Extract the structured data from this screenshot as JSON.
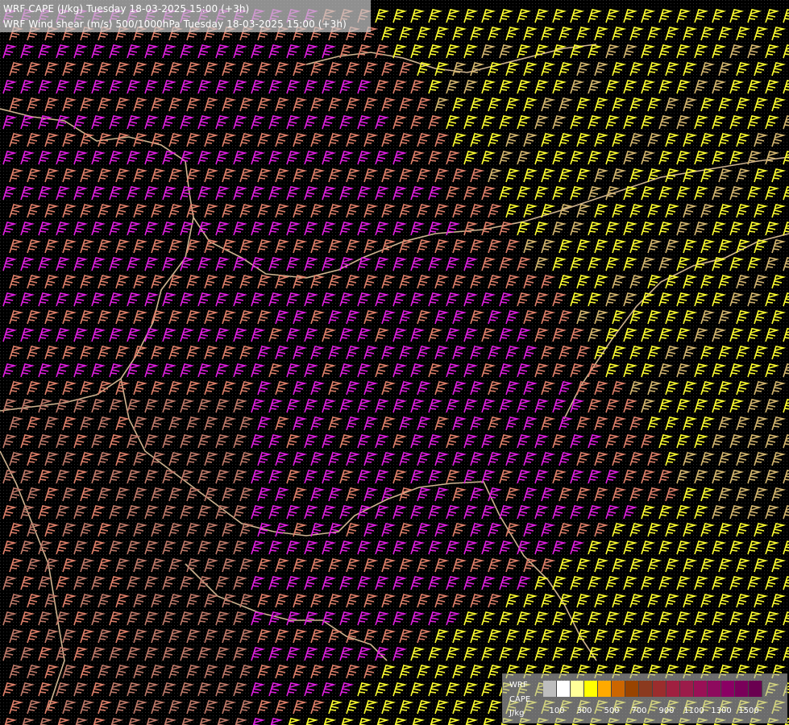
{
  "header": {
    "line1": "WRF CAPE (J/kg) Tuesday 18-03-2025 15:00 (+3h)",
    "line2": "WRF Wind shear (m/s) 500/1000hPa Tuesday 18-03-2025 15:00 (+3h)"
  },
  "legend": {
    "label_model": "WRF",
    "label_field": "CAPE",
    "label_unit": "J/kg",
    "colors": [
      "#bdbdbd",
      "#ffffff",
      "#ffff99",
      "#ffff00",
      "#ffaa00",
      "#cc6600",
      "#994400",
      "#8b3a1f",
      "#9b2d2d",
      "#a02040",
      "#9c1c4a",
      "#9a1056",
      "#8e0a5e",
      "#8a0064",
      "#7a005a",
      "#6a0050"
    ],
    "ticks": [
      "100",
      "300",
      "500",
      "700",
      "900",
      "1100",
      "1300",
      "1500"
    ]
  },
  "barb_palette": {
    "magenta": "#e01ee0",
    "salmon": "#e0806a",
    "dusty_rose": "#c07a6a",
    "yellow": "#ffff30",
    "tan": "#d6b870"
  },
  "map_colors": {
    "background": "#000000",
    "border": "#e6c8a0",
    "river": "#3060a0"
  }
}
